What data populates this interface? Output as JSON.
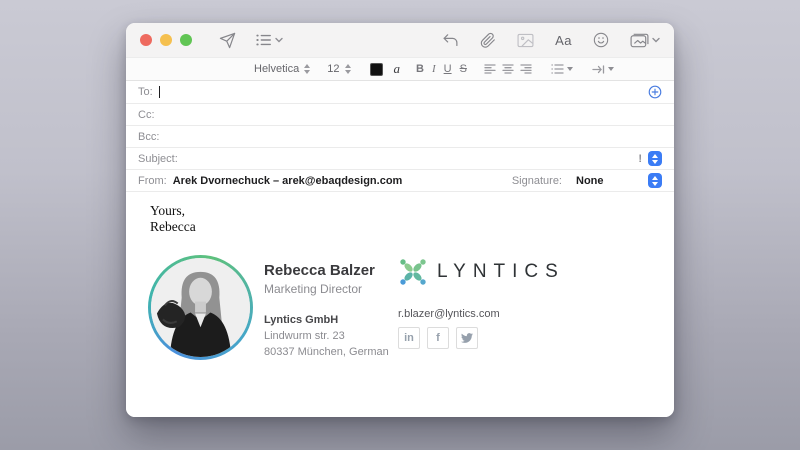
{
  "toolbar": {
    "format_label": "Aa"
  },
  "format_bar": {
    "font_family": "Helvetica",
    "font_size": "12",
    "color_glyph": "a",
    "styles": [
      "B",
      "I",
      "U",
      "S"
    ]
  },
  "fields": {
    "to_label": "To:",
    "cc_label": "Cc:",
    "bcc_label": "Bcc:",
    "subject_label": "Subject:",
    "priority_mark": "!",
    "from_label": "From:",
    "from_value": "Arek Dvornechuck – arek@ebaqdesign.com",
    "signature_label": "Signature:",
    "signature_value": "None"
  },
  "message": {
    "line1": "Yours,",
    "line2": "Rebecca"
  },
  "signature_card": {
    "name": "Rebecca Balzer",
    "job_title": "Marketing Director",
    "company": "Lyntics GmbH",
    "address_line1": "Lindwurm str. 23",
    "address_line2": "80337 München, German",
    "logo_text": "LYNTICS",
    "email": "r.blazer@lyntics.com",
    "social": {
      "linkedin": "in",
      "facebook": "f"
    }
  },
  "colors": {
    "accent_blue": "#3b7cf5",
    "logo_green": "#6cc184",
    "logo_blue": "#4a9bd8",
    "traffic_red": "#ee6a5f",
    "traffic_yellow": "#f5c04f",
    "traffic_green": "#61c554"
  }
}
